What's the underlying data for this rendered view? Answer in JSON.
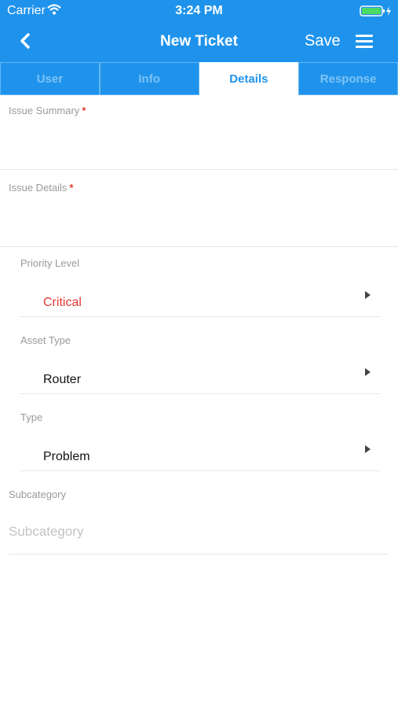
{
  "status_bar": {
    "carrier": "Carrier",
    "time": "3:24 PM"
  },
  "nav": {
    "title": "New Ticket",
    "save_label": "Save"
  },
  "tabs": [
    {
      "label": "User",
      "active": false
    },
    {
      "label": "Info",
      "active": false
    },
    {
      "label": "Details",
      "active": true
    },
    {
      "label": "Response",
      "active": false
    }
  ],
  "form": {
    "issue_summary": {
      "label": "Issue Summary",
      "required_mark": "*",
      "value": ""
    },
    "issue_details": {
      "label": "Issue Details",
      "required_mark": "*",
      "value": ""
    },
    "priority_level": {
      "label": "Priority Level",
      "value": "Critical"
    },
    "asset_type": {
      "label": "Asset Type",
      "value": "Router"
    },
    "type": {
      "label": "Type",
      "value": "Problem"
    },
    "subcategory": {
      "label": "Subcategory",
      "placeholder": "Subcategory"
    }
  },
  "colors": {
    "header": "#1f93ec",
    "required": "#e53935",
    "critical": "#e53935"
  },
  "icons": [
    "wifi-icon",
    "battery-icon",
    "back-chevron-icon",
    "hamburger-menu-icon",
    "disclosure-arrow-icon"
  ]
}
